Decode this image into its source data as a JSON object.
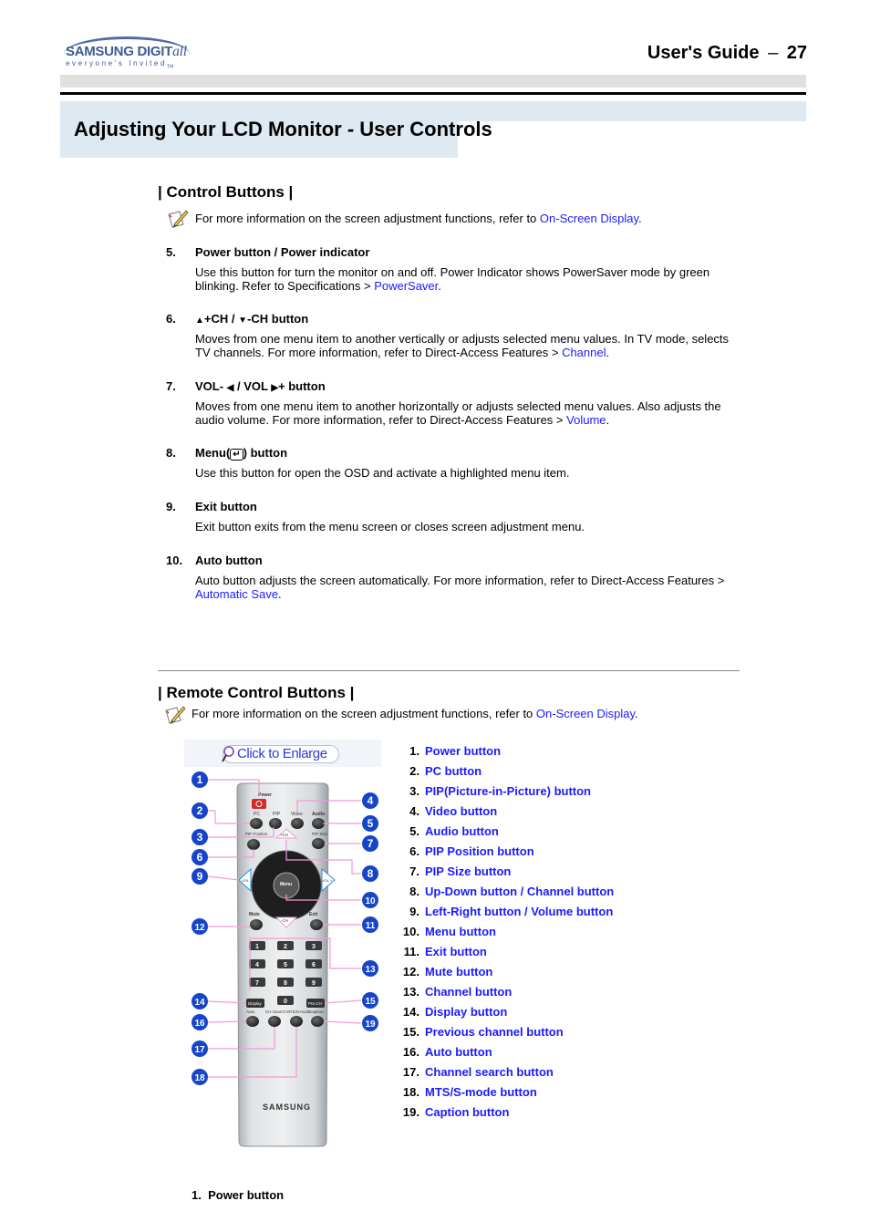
{
  "header": {
    "logo": {
      "brand": "SAMSUNG DIGIT",
      "brand_suffix": "all",
      "tagline": "everyone's Invited",
      "tm": "TM"
    },
    "guide_title": "User's Guide",
    "separator": "–",
    "page_number": "27"
  },
  "page_title": "Adjusting Your LCD Monitor - User Controls",
  "control_section": {
    "title": "| Control Buttons |",
    "note_prefix": "For more information on the screen adjustment functions, refer to ",
    "note_link": "On-Screen Display",
    "note_suffix": ".",
    "items": [
      {
        "num": "5.",
        "heading": "Power button / Power indicator",
        "body_prefix": "Use this button for turn the monitor on and off. Power Indicator shows PowerSaver mode by green blinking. Refer to Specifications > ",
        "link": "PowerSaver",
        "body_suffix": "."
      },
      {
        "num": "6.",
        "heading_up": "▲",
        "heading_mid": "+CH / ",
        "heading_down": "▼",
        "heading_end": "-CH button",
        "body_prefix": "Moves from one menu item to another vertically or adjusts selected menu values. In TV mode, selects TV channels. For more information, refer to Direct-Access Features > ",
        "link": "Channel",
        "body_suffix": "."
      },
      {
        "num": "7.",
        "heading_a": "VOL- ",
        "heading_left": "◀",
        "heading_b": " / VOL ",
        "heading_right": "▶",
        "heading_c": "+ button",
        "body_prefix": "Moves from one menu item to another horizontally or adjusts selected menu values. Also adjusts the audio volume. For more information, refer to Direct-Access Features > ",
        "link": "Volume",
        "body_suffix": "."
      },
      {
        "num": "8.",
        "heading_a": "Menu(",
        "heading_icon": "↵",
        "heading_b": ") button",
        "body": "Use this button for open the OSD and activate a highlighted menu item."
      },
      {
        "num": "9.",
        "heading": "Exit button",
        "body": "Exit button exits from the menu screen or closes screen adjustment menu."
      },
      {
        "num": "10.",
        "heading": "Auto button",
        "body_prefix": "Auto button adjusts the screen automatically. For more information, refer to Direct-Access Features > ",
        "link": "Automatic Save",
        "body_suffix": "."
      }
    ]
  },
  "remote_section": {
    "title": "| Remote Control Buttons |",
    "note_prefix": "For more information on the screen adjustment functions, refer to ",
    "note_link": "On-Screen Display",
    "note_suffix": ".",
    "enlarge_label": "Click to Enlarge",
    "remote_labels": {
      "power": "Power",
      "pc": "PC",
      "pip": "PIP",
      "video": "Video",
      "audio": "Audio",
      "pip_position": "PIP Position",
      "pip_size": "PIP Size",
      "ch_up": "+CH",
      "ch_down": "-CH",
      "vol_minus": "VOL -",
      "vol_plus": "VOL +",
      "menu": "Menu",
      "mute": "Mute",
      "exit": "Exit",
      "display": "Display",
      "pre_ch": "Pre.CH",
      "auto": "Auto",
      "ch_search": "CH Search",
      "mts": "MTS/S-mode",
      "caption": "Caption",
      "brand": "SAMSUNG",
      "digits": [
        "1",
        "2",
        "3",
        "4",
        "5",
        "6",
        "7",
        "8",
        "9",
        "0"
      ]
    },
    "callouts": [
      "1",
      "2",
      "3",
      "4",
      "5",
      "6",
      "7",
      "8",
      "9",
      "10",
      "11",
      "12",
      "13",
      "14",
      "15",
      "16",
      "17",
      "18",
      "19"
    ],
    "list": [
      {
        "num": "1.",
        "label": "Power button"
      },
      {
        "num": "2.",
        "label": "PC button"
      },
      {
        "num": "3.",
        "label": "PIP(Picture-in-Picture) button"
      },
      {
        "num": "4.",
        "label": "Video button"
      },
      {
        "num": "5.",
        "label": "Audio button"
      },
      {
        "num": "6.",
        "label": "PIP Position button"
      },
      {
        "num": "7.",
        "label": "PIP Size button"
      },
      {
        "num": "8.",
        "label": "Up-Down button / Channel button"
      },
      {
        "num": "9.",
        "label": "Left-Right button / Volume button"
      },
      {
        "num": "10.",
        "label": "Menu button"
      },
      {
        "num": "11.",
        "label": "Exit button"
      },
      {
        "num": "12.",
        "label": "Mute button"
      },
      {
        "num": "13.",
        "label": "Channel button"
      },
      {
        "num": "14.",
        "label": "Display button"
      },
      {
        "num": "15.",
        "label": "Previous channel button"
      },
      {
        "num": "16.",
        "label": "Auto button"
      },
      {
        "num": "17.",
        "label": "Channel search button"
      },
      {
        "num": "18.",
        "label": "MTS/S-mode button"
      },
      {
        "num": "19.",
        "label": "Caption button"
      }
    ]
  },
  "bottom_item": {
    "num": "1.",
    "label": "Power button"
  },
  "colors": {
    "link": "#1a1aff",
    "title_band": "#dfe9f1",
    "gray_band": "#e0e0e0",
    "callout": "#1745c8",
    "leader": "#f19ad8"
  }
}
